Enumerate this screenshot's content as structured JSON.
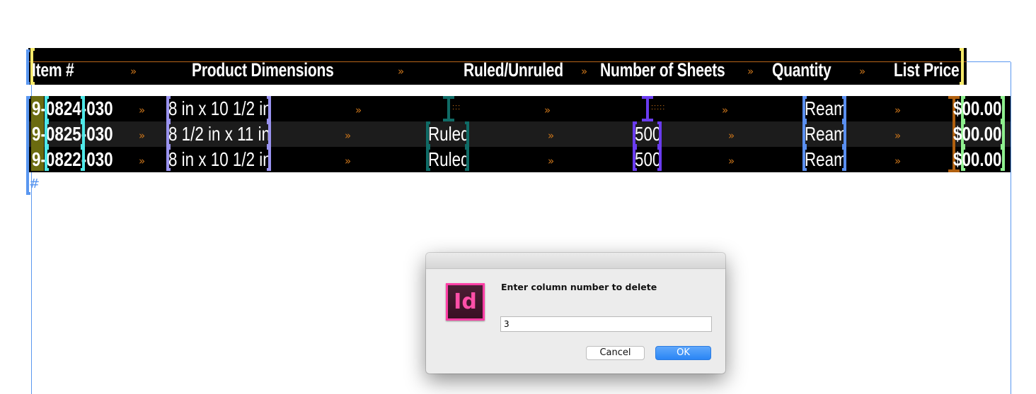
{
  "document": {
    "header_row": [
      "Item #",
      "Product Dimensions",
      "Ruled/Unruled",
      "Number of Sheets",
      "Quantity",
      "List Price"
    ],
    "rows": [
      {
        "item": "9-0824-030",
        "dimensions": "8 in x 10 1/2 in",
        "ruled": "",
        "sheets": "",
        "quantity": "Ream",
        "price": "$00.00"
      },
      {
        "item": "9-0825-030",
        "dimensions": "8 1/2 in x 11 in",
        "ruled": "Ruled",
        "sheets": "500",
        "quantity": "Ream",
        "price": "$00.00"
      },
      {
        "item": "9-0822-030",
        "dimensions": "8 in x 10 1/2 in",
        "ruled": "Ruled",
        "sheets": "500",
        "quantity": "Ream",
        "price": "$00.00"
      }
    ],
    "tab_glyph": "»",
    "end_of_story_glyph": "#",
    "colors": {
      "tab_marker": "#c9741a",
      "frame_guide": "#5a97f0",
      "header_tag": "#f5e96a",
      "item_tag": "#4fe8e8",
      "dimensions_tag": "#9a93f0",
      "ruled_tag": "#0f6b66",
      "sheets_tag": "#6a3cf0",
      "quantity_tag": "#5a8ff0",
      "price_tag": "#8ef08e"
    }
  },
  "dialog": {
    "app_icon_label": "Id",
    "prompt": "Enter column number to delete",
    "input_value": "3",
    "cancel_label": "Cancel",
    "ok_label": "OK"
  }
}
